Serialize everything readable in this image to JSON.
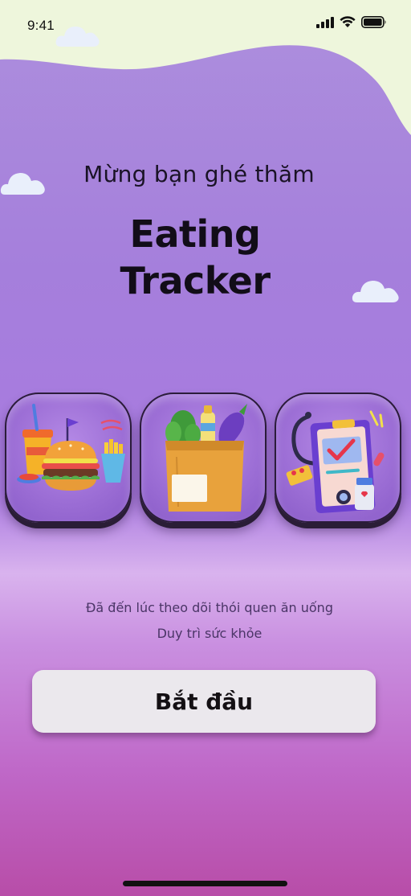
{
  "status_bar": {
    "time": "9:41"
  },
  "welcome": {
    "greeting": "Mừng bạn ghé thăm",
    "title_line1": "Eating",
    "title_line2": "Tracker"
  },
  "tiles": [
    {
      "icon": "fast-food-icon"
    },
    {
      "icon": "grocery-bag-icon"
    },
    {
      "icon": "health-checkup-icon"
    }
  ],
  "tagline": {
    "line1": "Đã đến lúc theo dõi thói quen ăn uống",
    "line2": "Duy trì sức khỏe"
  },
  "start_button": {
    "label": "Bắt đầu"
  },
  "colors": {
    "background_top": "#ad8fdd",
    "background_bottom": "#b84da8",
    "top_wave": "#eef6dc",
    "button": "#ebe8ed",
    "title": "#120d18"
  }
}
